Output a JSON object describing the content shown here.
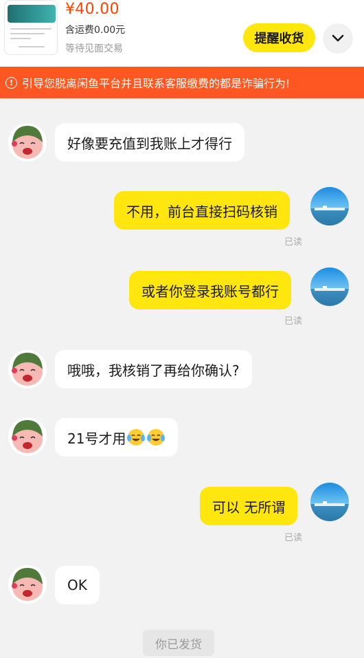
{
  "order": {
    "price": "¥40.00",
    "shipping": "含运费0.00元",
    "status": "等待见面交易",
    "remind_button": "提醒收货"
  },
  "warning": {
    "text": "引导您脱离闲鱼平台并且联系客服缴费的都是诈骗行为!"
  },
  "messages": [
    {
      "side": "left",
      "text": "好像要充值到我账上才得行"
    },
    {
      "side": "right",
      "text": "不用，前台直接扫码核销",
      "read": "已读"
    },
    {
      "side": "right",
      "text": "或者你登录我账号都行",
      "read": "已读"
    },
    {
      "side": "left",
      "text": "哦哦，我核销了再给你确认?"
    },
    {
      "side": "left",
      "text": "21号才用",
      "emoji": "tears-of-joy-emoji"
    },
    {
      "side": "right",
      "text": "可以 无所谓",
      "read": "已读"
    },
    {
      "side": "left",
      "text": "OK"
    }
  ],
  "footer": {
    "shipped_label": "你已发货"
  },
  "colors": {
    "accent_yellow": "#ffe60f",
    "warning_orange": "#ff5722",
    "price_red": "#ff4400"
  },
  "icons": [
    "product-thumbnail",
    "chevron-down-icon",
    "info-icon",
    "cartoon-avatar",
    "sea-photo-avatar"
  ]
}
